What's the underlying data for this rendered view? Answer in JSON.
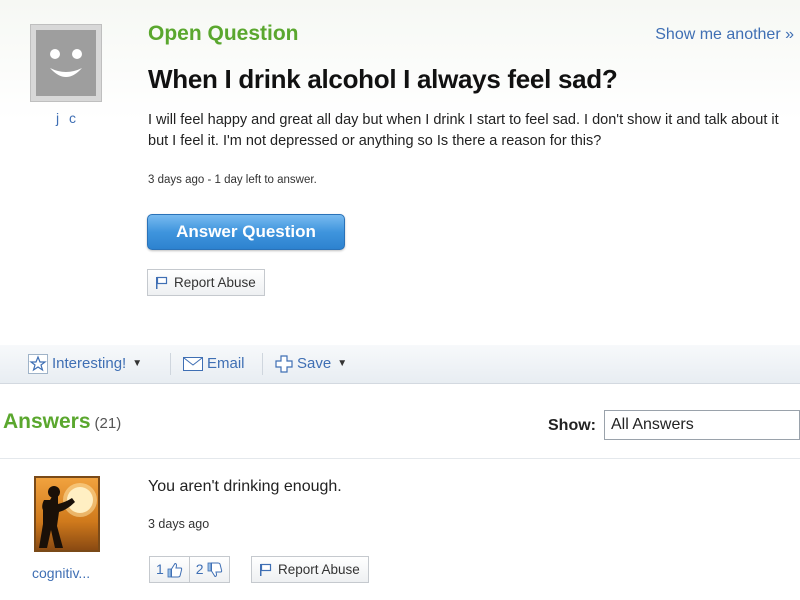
{
  "question": {
    "label": "Open Question",
    "show_another": "Show me another »",
    "asker": "j c",
    "title": "When I drink alcohol I always feel sad?",
    "body": "I will feel happy and great all day but when I drink I start to feel sad. I don't show it and talk about it but I feel it. I'm not depressed or anything so Is there a reason for this?",
    "meta": "3 days ago - 1 day left to answer.",
    "answer_button": "Answer Question",
    "report_abuse": "Report Abuse"
  },
  "toolbar": {
    "interesting": "Interesting!",
    "email": "Email",
    "save": "Save"
  },
  "answers": {
    "title": "Answers",
    "count": "(21)",
    "show_label": "Show:",
    "show_value": "All Answers",
    "items": [
      {
        "author": "cognitiv...",
        "text": "You aren't drinking enough.",
        "meta": "3 days ago",
        "thumbs_up": "1",
        "thumbs_down": "2",
        "report_abuse": "Report Abuse"
      }
    ]
  },
  "icons": {
    "avatar_default": "smiley-avatar-icon",
    "flag": "flag-icon",
    "star": "star-icon",
    "email": "envelope-icon",
    "save": "plus-icon",
    "thumbs_up": "thumbs-up-icon",
    "thumbs_down": "thumbs-down-icon"
  },
  "colors": {
    "accent_green": "#5aa72e",
    "link_blue": "#3f6fb4",
    "button_blue": "#3f95dd"
  }
}
